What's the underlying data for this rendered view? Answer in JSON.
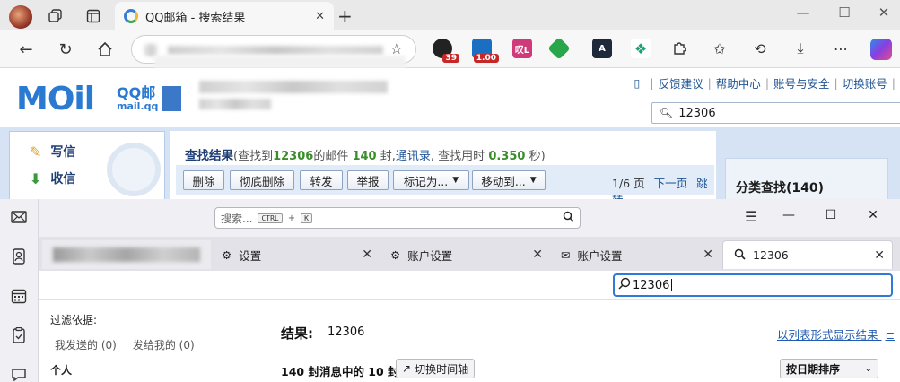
{
  "browser": {
    "tab_title": "QQ邮箱 - 搜索结果",
    "new_tab": "+",
    "ext_badge_1": "39",
    "ext_badge_2": "1.00",
    "ext_label_3": "叹L"
  },
  "qq": {
    "logo": "MOil",
    "logo_sub": "QQ邮",
    "logo_url": "mail.qq",
    "toplinks": [
      "反馈建议",
      "帮助中心",
      "账号与安全",
      "切换账号"
    ],
    "search_value": "12306",
    "sidebar": {
      "compose": "写信",
      "inbox": "收信"
    },
    "result_title": "查找结果",
    "result_text_1": "(查找到",
    "result_count_a": "12306",
    "result_text_2": "的邮件",
    "result_count_b": "140",
    "result_text_3": "封,",
    "result_contacts": "通讯录",
    "result_text_4": ", 查找用时",
    "result_time": "0.350",
    "result_text_5": "秒)",
    "buttons": {
      "delete": "删除",
      "purge": "彻底删除",
      "forward": "转发",
      "report": "举报",
      "mark_as": "标记为...",
      "move_to": "移动到..."
    },
    "pager": {
      "page": "1/6 页",
      "next": "下一页",
      "jump": "跳转"
    },
    "category_search": "分类查找(140)"
  },
  "tb": {
    "search_placeholder": "搜索...",
    "kbd_ctrl": "CTRL",
    "kbd_plus": "+",
    "kbd_k": "K",
    "tabs": {
      "settings": "设置",
      "account_settings_1": "账户设置",
      "account_settings_2": "账户设置",
      "search": "12306"
    },
    "find_value": "12306",
    "filter_title": "过滤依据:",
    "filter_sent": "我发送的 (0)",
    "filter_to": "发给我的 (0)",
    "filter_personal": "个人",
    "results_label": "结果:",
    "results_value": "12306",
    "list_view_link": "以列表形式显示结果",
    "count_text": "140 封消息中的 10 封",
    "timeline_button": "切换时间轴",
    "sort_select": "按日期排序"
  }
}
